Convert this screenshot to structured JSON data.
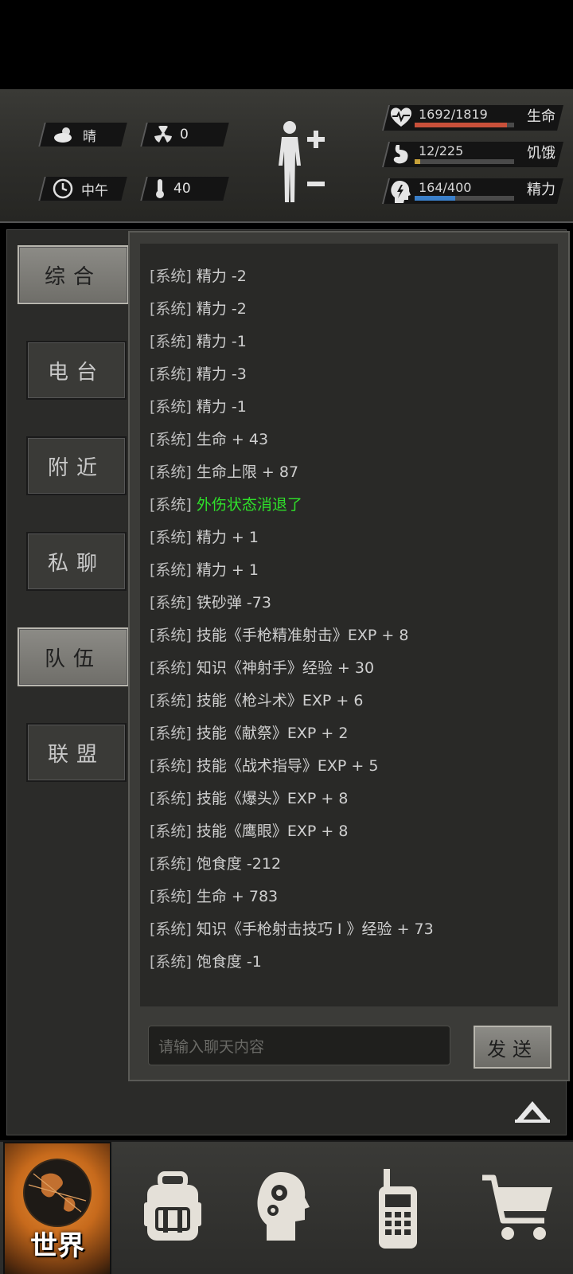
{
  "status": {
    "weather": "晴",
    "radiation": "0",
    "time_of_day": "中午",
    "temperature": "40"
  },
  "vitals": [
    {
      "label": "生命",
      "value": "1692/1819",
      "icon": "heart-pulse-icon",
      "fraction": 0.93,
      "color": "#c9503a"
    },
    {
      "label": "饥饿",
      "value": "12/225",
      "icon": "stomach-icon",
      "fraction": 0.053,
      "color": "#c8a23a"
    },
    {
      "label": "精力",
      "value": "164/400",
      "icon": "head-energy-icon",
      "fraction": 0.41,
      "color": "#3a7fc9"
    }
  ],
  "tabs": [
    {
      "label": "综合",
      "active": true
    },
    {
      "label": "电台",
      "active": false
    },
    {
      "label": "附近",
      "active": false
    },
    {
      "label": "私聊",
      "active": false
    },
    {
      "label": "队伍",
      "active": true
    },
    {
      "label": "联盟",
      "active": false
    }
  ],
  "chat": {
    "tag": "[系统]",
    "messages": [
      {
        "text": "精力 -2",
        "highlight": false
      },
      {
        "text": "精力 -2",
        "highlight": false
      },
      {
        "text": "精力 -1",
        "highlight": false
      },
      {
        "text": "精力 -3",
        "highlight": false
      },
      {
        "text": "精力 -1",
        "highlight": false
      },
      {
        "text": "生命 + 43",
        "highlight": false
      },
      {
        "text": "生命上限 + 87",
        "highlight": false
      },
      {
        "text": "外伤状态消退了",
        "highlight": true
      },
      {
        "text": "精力 + 1",
        "highlight": false
      },
      {
        "text": "精力 + 1",
        "highlight": false
      },
      {
        "text": "铁砂弹 -73",
        "highlight": false
      },
      {
        "text": "技能《手枪精准射击》EXP + 8",
        "highlight": false
      },
      {
        "text": "知识《神射手》经验 + 30",
        "highlight": false
      },
      {
        "text": "技能《枪斗术》EXP + 6",
        "highlight": false
      },
      {
        "text": "技能《献祭》EXP + 2",
        "highlight": false
      },
      {
        "text": "技能《战术指导》EXP + 5",
        "highlight": false
      },
      {
        "text": "技能《爆头》EXP + 8",
        "highlight": false
      },
      {
        "text": "技能《鹰眼》EXP + 8",
        "highlight": false
      },
      {
        "text": "饱食度 -212",
        "highlight": false
      },
      {
        "text": "生命 + 783",
        "highlight": false
      },
      {
        "text": "知识《手枪射击技巧 I 》经验 + 73",
        "highlight": false
      },
      {
        "text": "饱食度 -1",
        "highlight": false
      }
    ],
    "input_placeholder": "请输入聊天内容",
    "send_label": "发送"
  },
  "bottom_nav": [
    {
      "label": "世界",
      "icon": "globe-icon",
      "active": true
    },
    {
      "label": "",
      "icon": "backpack-icon",
      "active": false
    },
    {
      "label": "",
      "icon": "head-gears-icon",
      "active": false
    },
    {
      "label": "",
      "icon": "walkie-talkie-icon",
      "active": false
    },
    {
      "label": "",
      "icon": "shopping-cart-icon",
      "active": false
    }
  ]
}
